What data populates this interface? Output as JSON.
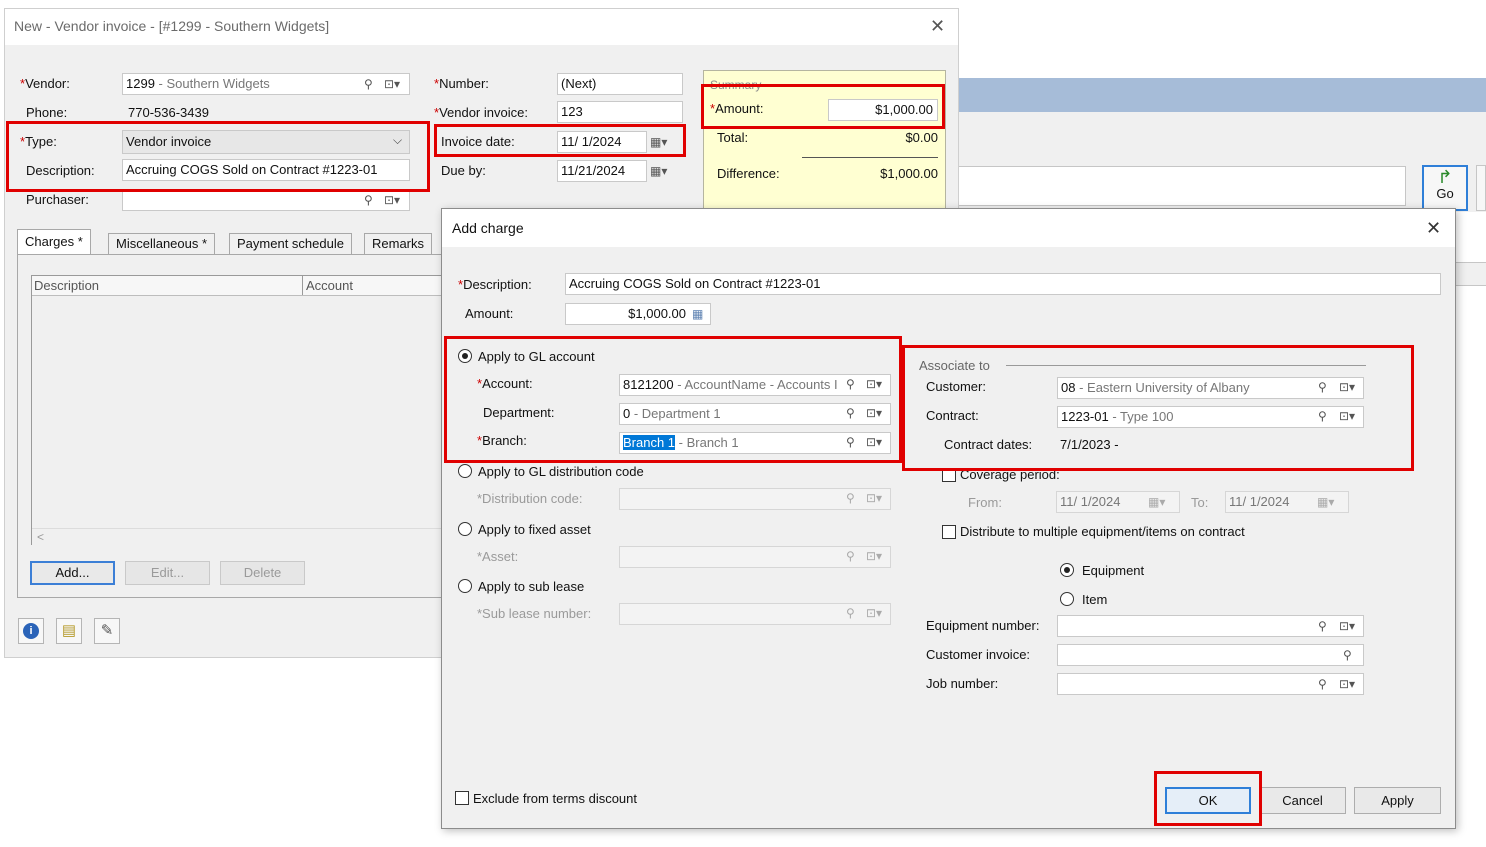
{
  "background_app": {
    "menu_text": "",
    "go_label": "Go"
  },
  "vendor_invoice": {
    "title": "New - Vendor invoice - [#1299 - Southern Widgets]",
    "vendor_label": "Vendor:",
    "vendor_code": "1299",
    "vendor_name": " - Southern Widgets",
    "phone_label": "Phone:",
    "phone_value": "770-536-3439",
    "type_label": "Type:",
    "type_value": "Vendor invoice",
    "description_label": "Description:",
    "description_value": "Accruing COGS Sold on Contract #1223-01",
    "purchaser_label": "Purchaser:",
    "number_label": "Number:",
    "number_value": "(Next)",
    "vendor_invoice_label": "Vendor invoice:",
    "vendor_invoice_value": "123",
    "invoice_date_label": "Invoice date:",
    "invoice_date_value": "11/  1/2024",
    "due_by_label": "Due by:",
    "due_by_value": "11/21/2024",
    "summary": {
      "legend": "Summary",
      "amount_label": "Amount:",
      "amount_value": "$1,000.00",
      "total_label": "Total:",
      "total_value": "$0.00",
      "difference_label": "Difference:",
      "difference_value": "$1,000.00"
    },
    "tabs": [
      {
        "label": "Charges *"
      },
      {
        "label": "Miscellaneous *"
      },
      {
        "label": "Payment schedule"
      },
      {
        "label": "Remarks"
      }
    ],
    "grid_columns": [
      "Description",
      "Account"
    ],
    "add_button": "Add...",
    "edit_button": "Edit...",
    "delete_button": "Delete"
  },
  "add_charge": {
    "title": "Add charge",
    "description_label": "Description:",
    "description_value": "Accruing COGS Sold on Contract #1223-01",
    "amount_label": "Amount:",
    "amount_value": "$1,000.00",
    "apply_gl_account": "Apply to GL account",
    "account_label": "Account:",
    "account_code": "8121200",
    "account_name": " - AccountName - Accounts I",
    "department_label": "Department:",
    "department_code": "0",
    "department_name": " - Department 1",
    "branch_label": "Branch:",
    "branch_code": "Branch 1",
    "branch_name": " - Branch 1",
    "apply_gl_distribution": "Apply to GL distribution code",
    "distribution_code_label": "*Distribution code:",
    "apply_fixed_asset": "Apply to fixed asset",
    "asset_label": "*Asset:",
    "apply_sub_lease": "Apply to sub lease",
    "sub_lease_label": "*Sub lease number:",
    "associate_to": "Associate to",
    "customer_label": "Customer:",
    "customer_code": "08",
    "customer_name": " - Eastern University of Albany",
    "contract_label": "Contract:",
    "contract_code": "1223-01",
    "contract_name": " - Type 100",
    "contract_dates_label": "Contract dates:",
    "contract_dates_value": "7/1/2023 -",
    "coverage_period": "Coverage period:",
    "from_label": "From:",
    "from_value": "11/  1/2024",
    "to_label": "To:",
    "to_value": "11/  1/2024",
    "distribute_multiple": "Distribute to multiple equipment/items on contract",
    "equipment_radio": "Equipment",
    "item_radio": "Item",
    "equipment_number_label": "Equipment number:",
    "customer_invoice_label": "Customer invoice:",
    "job_number_label": "Job number:",
    "exclude_discount": "Exclude from terms discount",
    "ok_button": "OK",
    "cancel_button": "Cancel",
    "apply_button": "Apply"
  },
  "colors": {
    "highlight_red": "#e00000",
    "summary_bg": "#ffffd2",
    "selection_blue": "#0078d7",
    "background_band": "#a6bcd8"
  }
}
